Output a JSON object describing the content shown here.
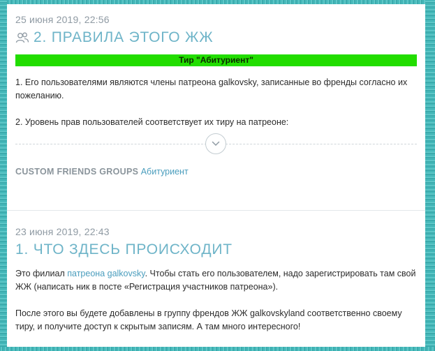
{
  "posts": [
    {
      "date": "25 июня 2019, 22:56",
      "title": "2. ПРАВИЛА ЭТОГО ЖЖ",
      "tier_banner": "Тир \"Абитуриент\"",
      "paragraph1": "1. Его пользователями являются члены патреона galkovsky, записанные во френды согласно их пожеланию.",
      "paragraph2": "2. Уровень прав пользователей соответствует их тиру на патреоне:",
      "custom_groups_label": "CUSTOM FRIENDS GROUPS",
      "custom_groups_value": "Абитуриент"
    },
    {
      "date": "23 июня 2019, 22:43",
      "title": "1. ЧТО ЗДЕСЬ ПРОИСХОДИТ",
      "paragraph1_before": "Это филиал ",
      "paragraph1_link": "патреона galkovsky",
      "paragraph1_after": ". Чтобы стать его пользователем, надо зарегистрировать там свой ЖЖ (написать ник в посте «Регистрация участников патреона»).",
      "paragraph2": "После этого вы будете добавлены в группу френдов ЖЖ galkovskyland соответственно своему тиру, и получите доступ к скрытым записям. А там много интересного!"
    }
  ],
  "icons": {
    "group": "group-icon",
    "expand": "chevron-down-icon"
  },
  "colors": {
    "frame": "#3fb6b6",
    "title": "#6eb4c8",
    "link": "#4a9dbd",
    "banner": "#22dd00"
  }
}
